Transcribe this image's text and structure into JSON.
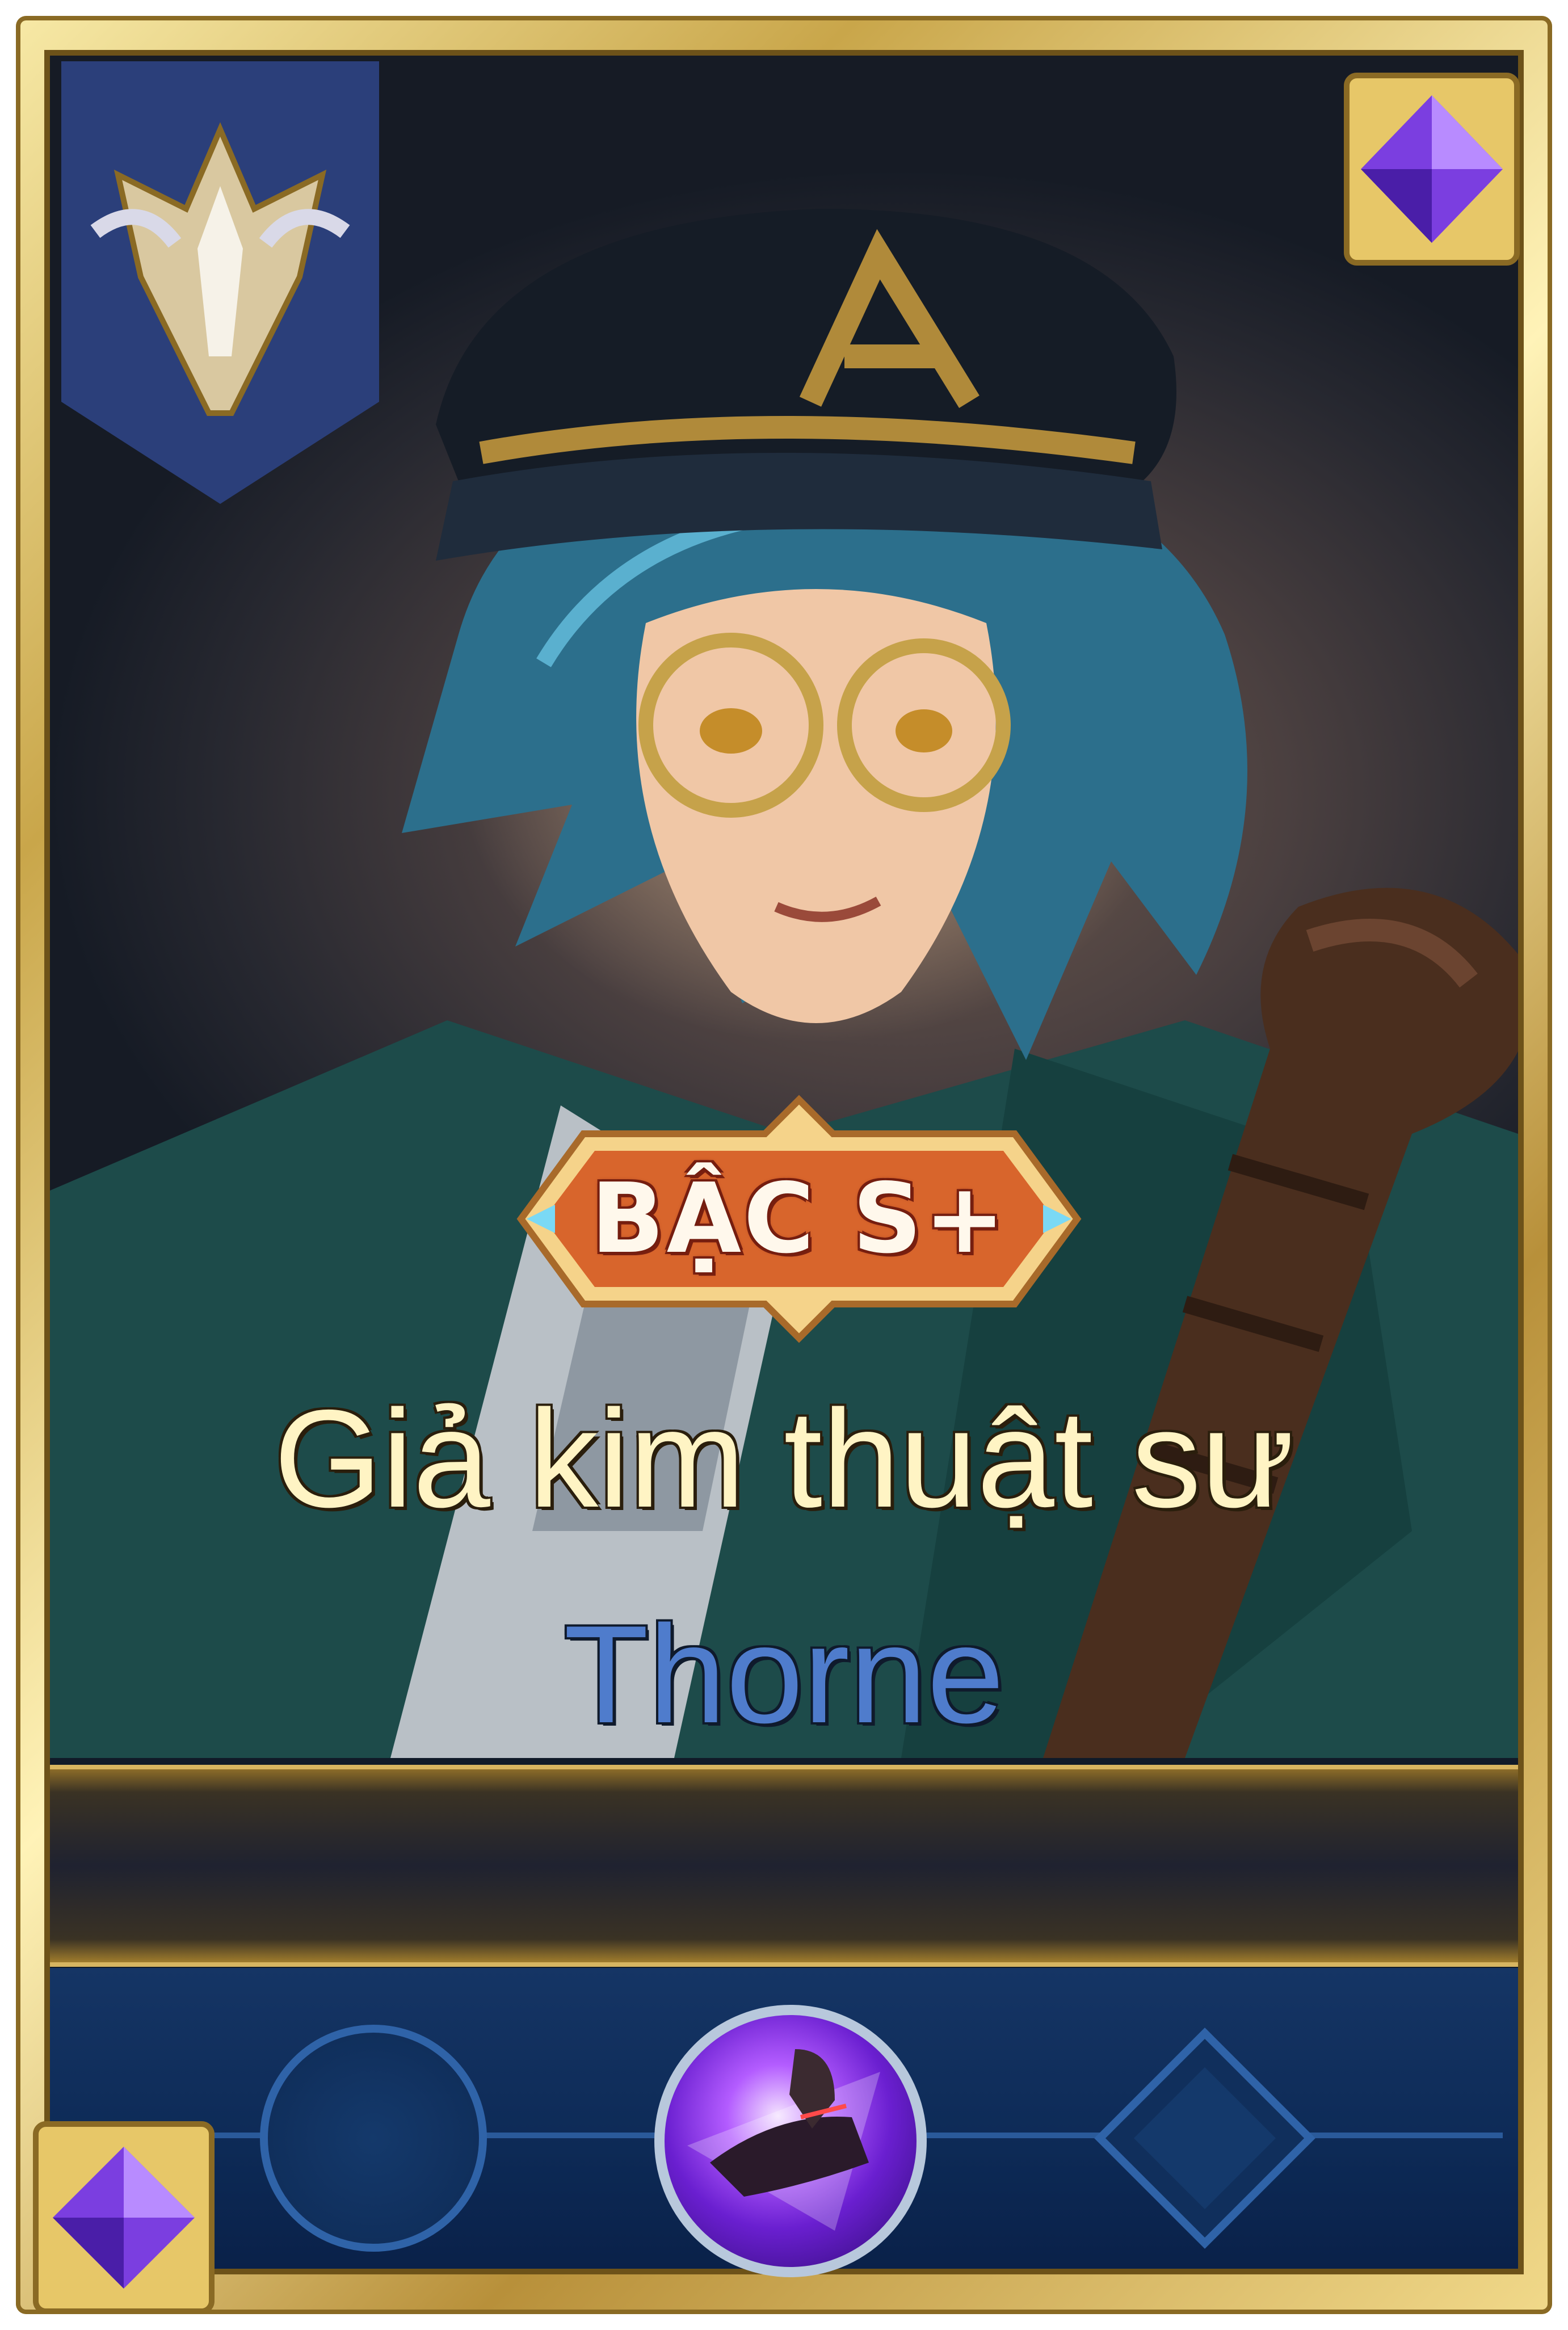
{
  "card": {
    "tier_label": "BẬC S+",
    "skin_name": "Giả kim thuật sư",
    "hero_name": "Thorne"
  },
  "colors": {
    "frame_gold": "#d9b75a",
    "banner_navy": "#2b3f7a",
    "hero_name_blue": "#4f7ccc",
    "skin_name_cream": "#fff4c4",
    "tier_badge_orange": "#d8652c",
    "slot_bar_blue": "#0d2a56"
  },
  "icons": {
    "rank_emblem": "rank-emblem-icon",
    "gem_top_right": "purple-gem-icon",
    "gem_bottom_left": "purple-gem-icon",
    "slot_left": "empty-circle-slot-icon",
    "slot_center": "skill-portrait-icon",
    "slot_right": "empty-diamond-slot-icon"
  }
}
